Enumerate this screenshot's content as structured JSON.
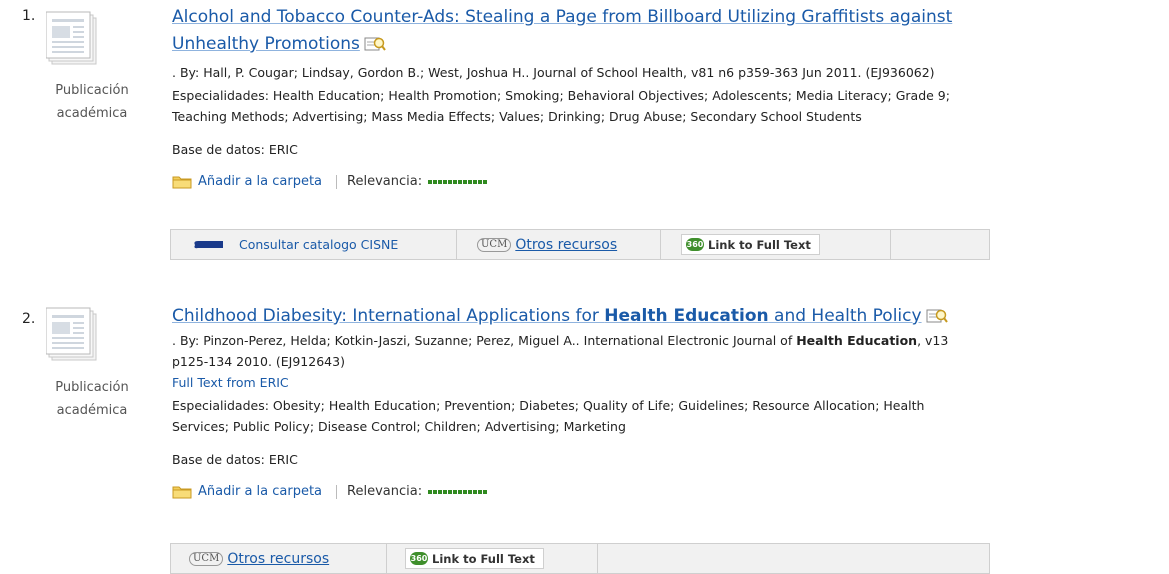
{
  "results": [
    {
      "number": "1.",
      "type_line1": "Publicación",
      "type_line2": "académica",
      "title_parts": [
        "Alcohol and Tobacco Counter-Ads: Stealing a Page from Billboard Utilizing Graffitists against",
        "Unhealthy Promotions"
      ],
      "citation": ". By: Hall, P. Cougar; Lindsay, Gordon B.; West, Joshua H.. Journal of School Health, v81 n6 p359-363 Jun 2011. (EJ936062)",
      "subjects_line1": "Especialidades: Health Education; Health Promotion; Smoking; Behavioral Objectives; Adolescents; Media Literacy; Grade 9;",
      "subjects_line2": "Teaching Methods; Advertising; Mass Media Effects; Values; Drinking; Drug Abuse; Secondary School Students",
      "database": "Base de datos: ERIC",
      "add_folder": "Añadir a la carpeta",
      "relevance_label": "Relevancia:",
      "links": {
        "catalog": "Consultar catalogo CISNE",
        "ucm": "UCM",
        "other": "Otros recursos",
        "badge": "360",
        "fulltext": "Link to Full Text"
      }
    },
    {
      "number": "2.",
      "type_line1": "Publicación",
      "type_line2": "académica",
      "title_a": "Childhood Diabesity: International Applications for ",
      "title_b": "Health Education",
      "title_c": " and Health Policy",
      "citation_a": ". By: Pinzon-Perez, Helda; Kotkin-Jaszi, Suzanne; Perez, Miguel A.. International Electronic Journal of ",
      "citation_b": "Health Education",
      "citation_c": ", v13",
      "citation_line2": "p125-134 2010. (EJ912643)",
      "fulltext_from": "Full Text from ERIC",
      "subjects_line1": "Especialidades: Obesity; Health Education; Prevention; Diabetes; Quality of Life; Guidelines; Resource Allocation; Health",
      "subjects_line2": "Services; Public Policy; Disease Control; Children; Advertising; Marketing",
      "database": "Base de datos: ERIC",
      "add_folder": "Añadir a la carpeta",
      "relevance_label": "Relevancia:",
      "links": {
        "ucm": "UCM",
        "other": "Otros recursos",
        "badge": "360",
        "fulltext": "Link to Full Text"
      }
    }
  ],
  "colors": {
    "link": "#1a5aa8",
    "relevance": "#2f8a1f",
    "badge360": "#3f8f2c"
  },
  "icons": [
    "document-icon",
    "preview-icon",
    "folder-icon",
    "cisne-icon",
    "ucm-icon",
    "badge-360-icon"
  ]
}
